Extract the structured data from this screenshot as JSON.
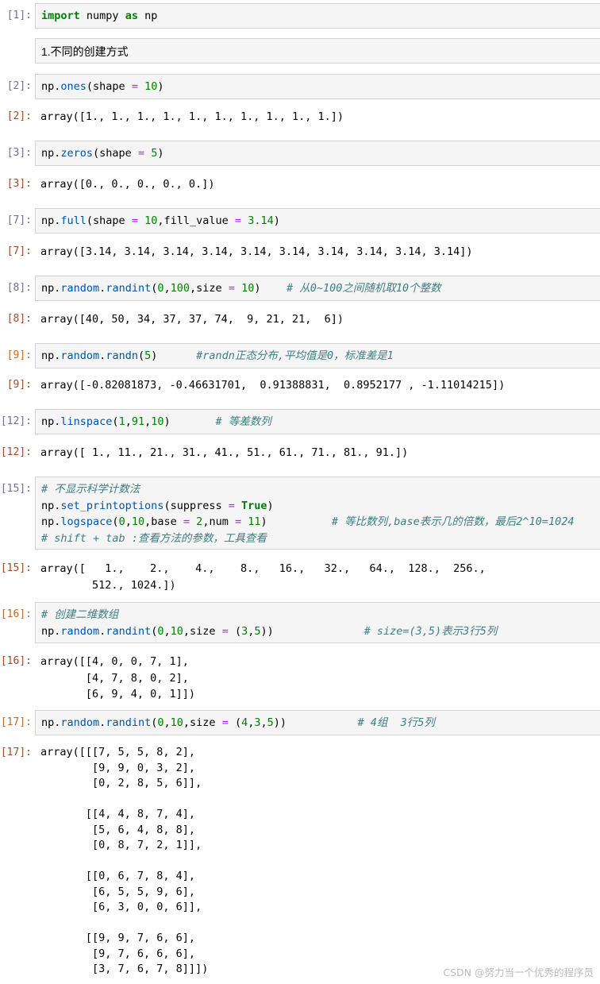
{
  "cells": [
    {
      "prompt": "[1]:",
      "input": [
        "import numpy as np"
      ]
    },
    {
      "markdown": "1.不同的创建方式"
    },
    {
      "prompt": "[2]:",
      "input": [
        "np.ones(shape = 10)"
      ],
      "out_prompt": "[2]:",
      "output": [
        "array([1., 1., 1., 1., 1., 1., 1., 1., 1., 1.])"
      ]
    },
    {
      "prompt": "[3]:",
      "input": [
        "np.zeros(shape = 5)"
      ],
      "out_prompt": "[3]:",
      "output": [
        "array([0., 0., 0., 0., 0.])"
      ]
    },
    {
      "prompt": "[7]:",
      "input": [
        "np.full(shape = 10,fill_value = 3.14)"
      ],
      "out_prompt": "[7]:",
      "output": [
        "array([3.14, 3.14, 3.14, 3.14, 3.14, 3.14, 3.14, 3.14, 3.14, 3.14])"
      ]
    },
    {
      "prompt": "[8]:",
      "input": [
        "np.random.randint(0,100,size = 10)    # 从0~100之间随机取10个整数"
      ],
      "out_prompt": "[8]:",
      "output": [
        "array([40, 50, 34, 37, 37, 74,  9, 21, 21,  6])"
      ]
    },
    {
      "prompt": "[9]:",
      "input": [
        "np.random.randn(5)      #randn正态分布,平均值是0，标准差是1"
      ],
      "out_prompt": "[9]:",
      "output": [
        "array([-0.82081873, -0.46631701,  0.91388831,  0.8952177 , -1.11014215])"
      ]
    },
    {
      "prompt": "[12]:",
      "input": [
        "np.linspace(1,91,10)       # 等差数列"
      ],
      "out_prompt": "[12]:",
      "output": [
        "array([ 1., 11., 21., 31., 41., 51., 61., 71., 81., 91.])"
      ]
    },
    {
      "prompt": "[15]:",
      "input": [
        "# 不显示科学计数法",
        "np.set_printoptions(suppress = True)",
        "np.logspace(0,10,base = 2,num = 11)          # 等比数列,base表示几的倍数，最后2^10=1024",
        "# shift + tab :查看方法的参数，工具查看"
      ],
      "out_prompt": "[15]:",
      "output": [
        "array([   1.,    2.,    4.,    8.,   16.,   32.,   64.,  128.,  256.,",
        "        512., 1024.])"
      ]
    },
    {
      "prompt": "[16]:",
      "input": [
        "# 创建二维数组",
        "np.random.randint(0,10,size = (3,5))              # size=(3,5)表示3行5列"
      ],
      "out_prompt": "[16]:",
      "output": [
        "array([[4, 0, 0, 7, 1],",
        "       [4, 7, 8, 0, 2],",
        "       [6, 9, 4, 0, 1]])"
      ]
    },
    {
      "prompt": "[17]:",
      "input": [
        "np.random.randint(0,10,size = (4,3,5))           # 4组  3行5列"
      ],
      "out_prompt": "[17]:",
      "output": [
        "array([[[7, 5, 5, 8, 2],",
        "        [9, 9, 0, 3, 2],",
        "        [0, 2, 8, 5, 6]],",
        "",
        "       [[4, 4, 8, 7, 4],",
        "        [5, 6, 4, 8, 8],",
        "        [0, 8, 7, 2, 1]],",
        "",
        "       [[0, 6, 7, 8, 4],",
        "        [6, 5, 5, 9, 6],",
        "        [6, 3, 0, 0, 6]],",
        "",
        "       [[9, 9, 7, 6, 6],",
        "        [9, 7, 6, 6, 6],",
        "        [3, 7, 6, 7, 8]]])"
      ]
    }
  ],
  "watermark": "CSDN @努力当一个优秀的程序员"
}
